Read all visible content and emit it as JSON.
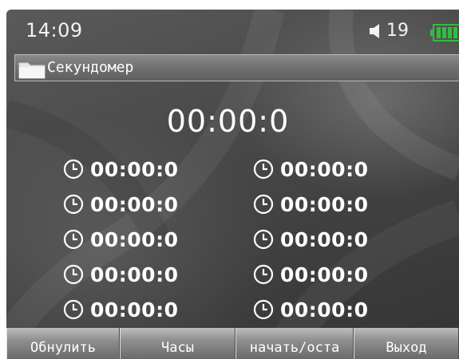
{
  "status": {
    "time": "14:09",
    "volume": "19",
    "icons": {
      "volume": "speaker-icon",
      "battery": "battery-icon"
    }
  },
  "titlebar": {
    "title": "Секундомер",
    "icon": "folder-icon"
  },
  "stopwatch": {
    "main_time": "00:00:0",
    "laps": [
      "00:00:0",
      "00:00:0",
      "00:00:0",
      "00:00:0",
      "00:00:0",
      "00:00:0",
      "00:00:0",
      "00:00:0",
      "00:00:0",
      "00:00:0"
    ],
    "lap_icon": "clock-icon"
  },
  "softkeys": {
    "reset": "Обнулить",
    "clock": "Часы",
    "start_stop": "начать/оста",
    "exit": "Выход"
  },
  "colors": {
    "background": "#444444",
    "text": "#ffffff",
    "battery": "#2fbf3a"
  }
}
